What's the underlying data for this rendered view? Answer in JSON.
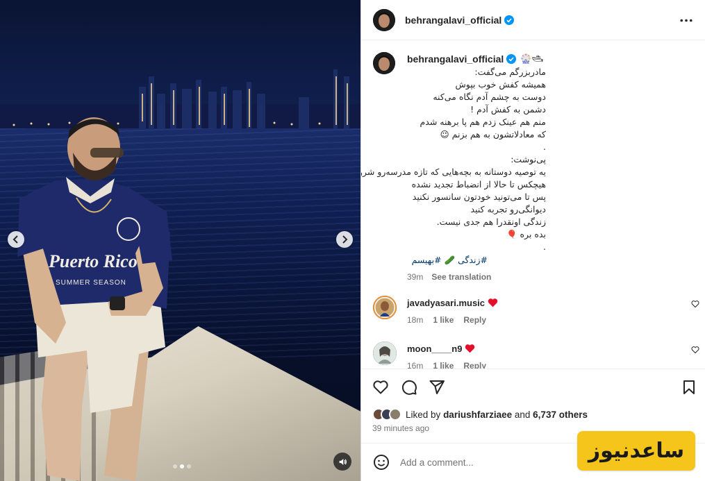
{
  "post": {
    "username": "behrangalavi_official",
    "caption_emojis": "🎡🛥",
    "caption_lines": [
      "مادربزرگم می‌گفت:",
      "همیشه کفش خوب بپوش",
      "دوست به چشم آدم نگاه می‌کنه",
      "دشمن به کفش آدم !",
      "منم هم عینک زدم هم پا برهنه شدم",
      "که معادلاتشون به هم بزنم 😉",
      ".",
      "پی‌نوشت:",
      "یه توصیه دوستانه به بچه‌هایی که تازه مدرسه‌رو شروع کردن",
      "هیچکس تا حالا از انضباط تجدید نشده",
      "پس تا می‌تونید خودتون سانسور نکنید",
      "دیوانگی‌رو تجربه کنید",
      "زندگی اونقدرا هم جدی نیست.",
      "بده بره 🎈",
      "."
    ],
    "hashtags": [
      "#زندگی",
      "🥒",
      "#بهیسم"
    ],
    "caption_time": "39m",
    "see_translation": "See translation"
  },
  "comments": [
    {
      "user": "javadyasari.music",
      "time": "18m",
      "likes": "1 like",
      "reply": "Reply"
    },
    {
      "user": "moon____n9",
      "time": "16m",
      "likes": "1 like",
      "reply": "Reply"
    }
  ],
  "likes": {
    "prefix": "Liked by",
    "user": "dariushfarziaee",
    "joiner": "and",
    "others": "6,737 others"
  },
  "posted_ago": "39 minutes ago",
  "add_comment": {
    "placeholder": "Add a comment..."
  },
  "carousel": {
    "count": 3,
    "active": 1
  },
  "watermark": "ساعدنیوز",
  "colors": {
    "verified": "#0095f6",
    "link": "#00376b",
    "muted": "#737373",
    "heart": "#ff3040",
    "watermark_bg": "#f6c51b"
  }
}
